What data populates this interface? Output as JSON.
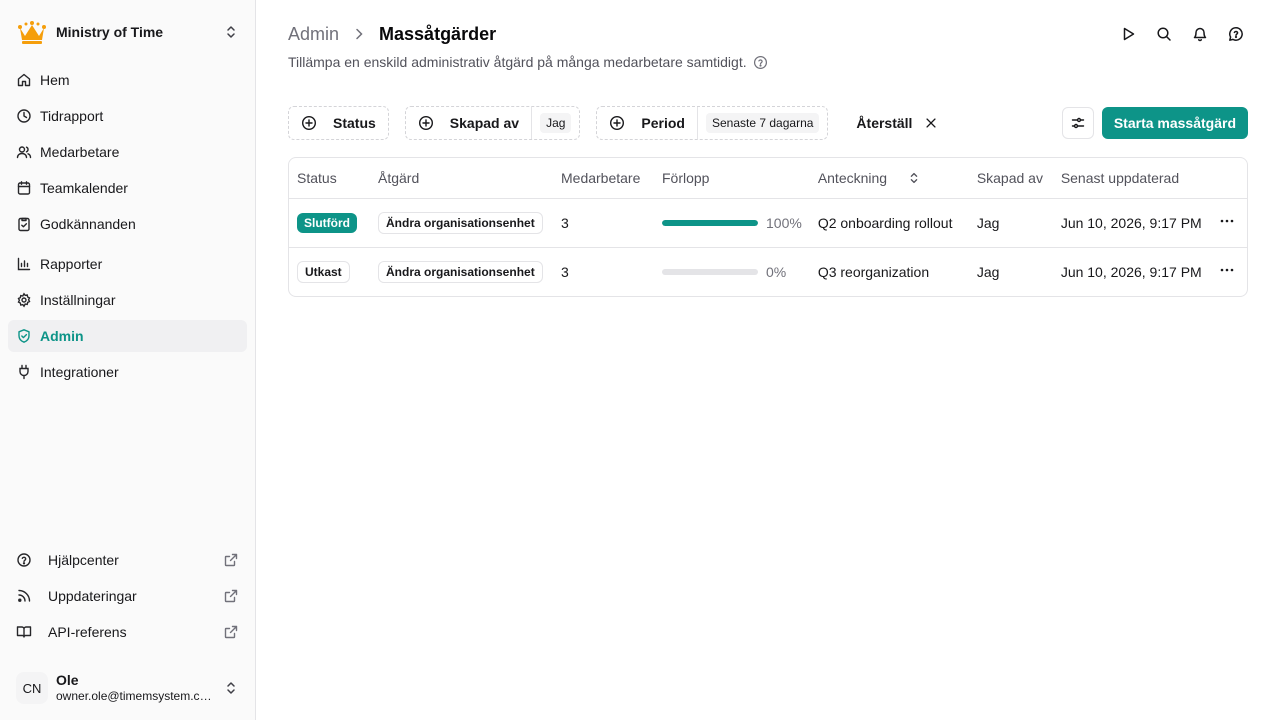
{
  "org": {
    "name": "Ministry of Time",
    "logo_color": "#f59e0b"
  },
  "sidebar": {
    "items": [
      {
        "label": "Hem",
        "icon": "home-icon"
      },
      {
        "label": "Tidrapport",
        "icon": "clock-icon"
      },
      {
        "label": "Medarbetare",
        "icon": "users-icon"
      },
      {
        "label": "Teamkalender",
        "icon": "calendar-icon"
      },
      {
        "label": "Godkännanden",
        "icon": "clipboard-check-icon"
      },
      {
        "label": "Rapporter",
        "icon": "chart-icon"
      },
      {
        "label": "Inställningar",
        "icon": "gear-icon"
      },
      {
        "label": "Admin",
        "icon": "shield-check-icon",
        "active": true
      },
      {
        "label": "Integrationer",
        "icon": "plug-icon"
      }
    ],
    "bottom_links": [
      {
        "label": "Hjälpcenter",
        "icon": "help-circle-icon"
      },
      {
        "label": "Uppdateringar",
        "icon": "rss-icon"
      },
      {
        "label": "API-referens",
        "icon": "book-icon"
      }
    ],
    "user": {
      "initials": "CN",
      "name": "Ole",
      "email": "owner.ole@timemsystem.com"
    }
  },
  "header": {
    "breadcrumb_parent": "Admin",
    "breadcrumb_current": "Massåtgärder",
    "subtitle": "Tillämpa en enskild administrativ åtgärd på många medarbetare samtidigt."
  },
  "filters": {
    "status_label": "Status",
    "created_by_label": "Skapad av",
    "created_by_value": "Jag",
    "period_label": "Period",
    "period_value": "Senaste 7 dagarna",
    "reset_label": "Återställ"
  },
  "primary_action": "Starta massåtgärd",
  "table": {
    "columns": [
      "Status",
      "Åtgärd",
      "Medarbetare",
      "Förlopp",
      "Anteckning",
      "Skapad av",
      "Senast uppdaterad"
    ],
    "rows": [
      {
        "status": "Slutförd",
        "status_kind": "done",
        "action": "Ändra organisationsenhet",
        "employees": "3",
        "progress": 100,
        "progress_label": "100%",
        "note": "Q2 onboarding rollout",
        "created_by": "Jag",
        "updated": "Jun 10, 2026, 9:17 PM"
      },
      {
        "status": "Utkast",
        "status_kind": "draft",
        "action": "Ändra organisationsenhet",
        "employees": "3",
        "progress": 0,
        "progress_label": "0%",
        "note": "Q3 reorganization",
        "created_by": "Jag",
        "updated": "Jun 10, 2026, 9:17 PM"
      }
    ]
  },
  "colors": {
    "accent": "#0d9488"
  }
}
